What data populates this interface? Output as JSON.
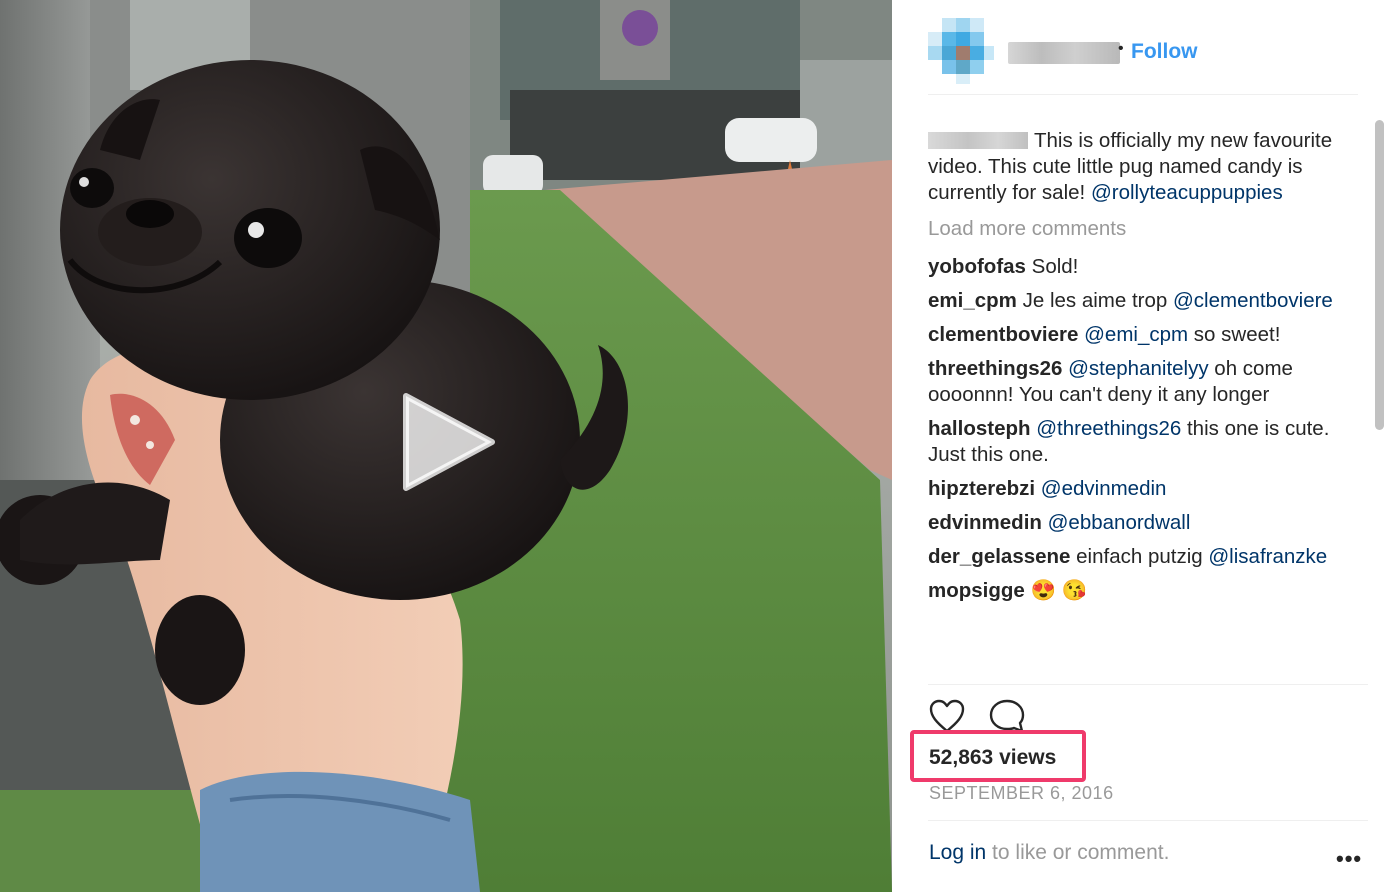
{
  "post": {
    "follow_label": "Follow",
    "caption": {
      "text": "This is officially my new favourite video. This cute little pug named candy is currently for sale!",
      "mention": "@rollyteacuppuppies"
    },
    "load_more_label": "Load more comments",
    "comments": [
      {
        "user": "yobofofas",
        "parts": [
          {
            "t": "Sold!",
            "m": false
          }
        ]
      },
      {
        "user": "emi_cpm",
        "parts": [
          {
            "t": "Je les aime trop",
            "m": false
          },
          {
            "t": "@clementboviere",
            "m": true
          }
        ]
      },
      {
        "user": "clementboviere",
        "parts": [
          {
            "t": "@emi_cpm",
            "m": true
          },
          {
            "t": "so sweet!",
            "m": false
          }
        ]
      },
      {
        "user": "threethings26",
        "parts": [
          {
            "t": "@stephanitelyy",
            "m": true
          },
          {
            "t": "oh come oooonnn! You can't deny it any longer",
            "m": false
          }
        ]
      },
      {
        "user": "hallosteph",
        "parts": [
          {
            "t": "@threethings26",
            "m": true
          },
          {
            "t": "this one is cute. Just this one.",
            "m": false
          }
        ]
      },
      {
        "user": "hipzterebzi",
        "parts": [
          {
            "t": "@edvinmedin",
            "m": true
          }
        ]
      },
      {
        "user": "edvinmedin",
        "parts": [
          {
            "t": "@ebbanordwall",
            "m": true
          }
        ]
      },
      {
        "user": "der_gelassene",
        "parts": [
          {
            "t": "einfach putzig",
            "m": false
          },
          {
            "t": "@lisafranzke",
            "m": true
          }
        ]
      },
      {
        "user": "mopsigge",
        "parts": [
          {
            "t": "😍 😘",
            "m": false
          }
        ]
      }
    ],
    "views": "52,863 views",
    "date": "SEPTEMBER 6, 2016",
    "footer": {
      "login_label": "Log in",
      "rest": " to like or comment.",
      "more_label": "•••"
    },
    "highlight_color": "#ef3a6b",
    "link_color": "#3897f0",
    "mention_color": "#003569"
  },
  "icons": {
    "play": "play-icon",
    "like": "heart-icon",
    "comment": "speech-bubble-icon",
    "more": "ellipsis-icon"
  }
}
